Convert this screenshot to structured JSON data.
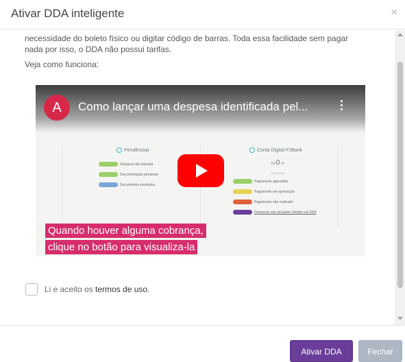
{
  "modal": {
    "title": "Ativar DDA inteligente",
    "close_glyph": "×"
  },
  "body": {
    "intro": "necessidade do boleto físico ou digitar código de barras. Toda essa facilidade sem pagar nada por isso, o DDA não possui tarifas.",
    "howto": "Veja como funciona:"
  },
  "video": {
    "channel_initial": "A",
    "title": "Como lançar uma despesa identificada pel...",
    "left_panel": {
      "heading": "Pendências",
      "items": [
        "Despesa não lançada",
        "Documentação pendente",
        "Documentos recebidos"
      ],
      "pill_colors": [
        "#9ccf6a",
        "#9ccf6a",
        "#7aa7d6"
      ]
    },
    "right_panel": {
      "heading": "Conta Digital PJBank",
      "balance_prefix": "R$",
      "balance_value": "0",
      "balance_cents": "00",
      "balance_label": "Saldo atual",
      "items": [
        "Pagamento agendado",
        "Pagamento em aprovação",
        "Pagamento não realizado",
        "Despesas não lançadas obtidas via DDA"
      ],
      "pill_colors": [
        "#9ccf6a",
        "#e6d35a",
        "#e0603a",
        "#6a3d9a"
      ]
    },
    "caption_lines": [
      "Quando houver alguma cobrança,",
      "clique no botão para visualiza-la"
    ],
    "colors": {
      "play": "#ff0000",
      "caption": "#d62e6d",
      "avatar": "#d6294a"
    }
  },
  "terms": {
    "prefix": "Li e aceito os ",
    "link": "termos de uso",
    "suffix": "."
  },
  "footer": {
    "activate_label": "Ativar DDA",
    "close_label": "Fechar",
    "colors": {
      "primary": "#6a3d9a",
      "secondary": "#aeb8c4"
    }
  },
  "icons": [
    "close-icon",
    "play-icon",
    "kebab-menu-icon",
    "checkbox-icon"
  ]
}
